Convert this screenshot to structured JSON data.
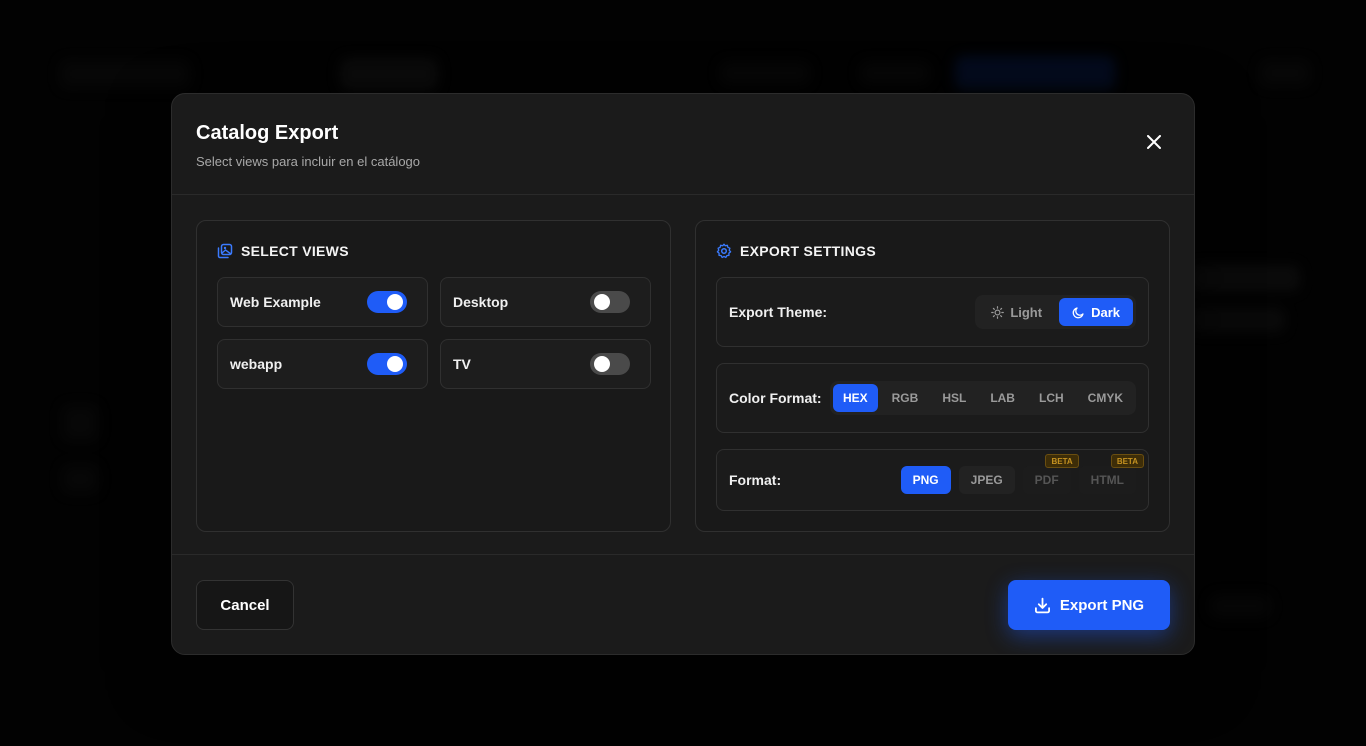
{
  "modal": {
    "title": "Catalog Export",
    "subtitle": "Select views para incluir en el catálogo"
  },
  "views_panel": {
    "heading": "SELECT VIEWS",
    "views": [
      {
        "label": "Web Example",
        "enabled": true
      },
      {
        "label": "Desktop",
        "enabled": false
      },
      {
        "label": "webapp",
        "enabled": true
      },
      {
        "label": "TV",
        "enabled": false
      }
    ]
  },
  "settings_panel": {
    "heading": "EXPORT SETTINGS",
    "theme": {
      "label": "Export Theme:",
      "options": [
        "Light",
        "Dark"
      ],
      "selected": "Dark"
    },
    "color_format": {
      "label": "Color Format:",
      "options": [
        "HEX",
        "RGB",
        "HSL",
        "LAB",
        "LCH",
        "CMYK"
      ],
      "selected": "HEX"
    },
    "format": {
      "label": "Format:",
      "options": [
        "PNG",
        "JPEG",
        "PDF",
        "HTML"
      ],
      "selected": "PNG",
      "beta_label": "BETA"
    }
  },
  "footer": {
    "cancel_label": "Cancel",
    "export_label": "Export PNG"
  },
  "colors": {
    "accent": "#1f5cf7",
    "modal_bg": "#1b1b1b",
    "beta": "#c59221"
  }
}
